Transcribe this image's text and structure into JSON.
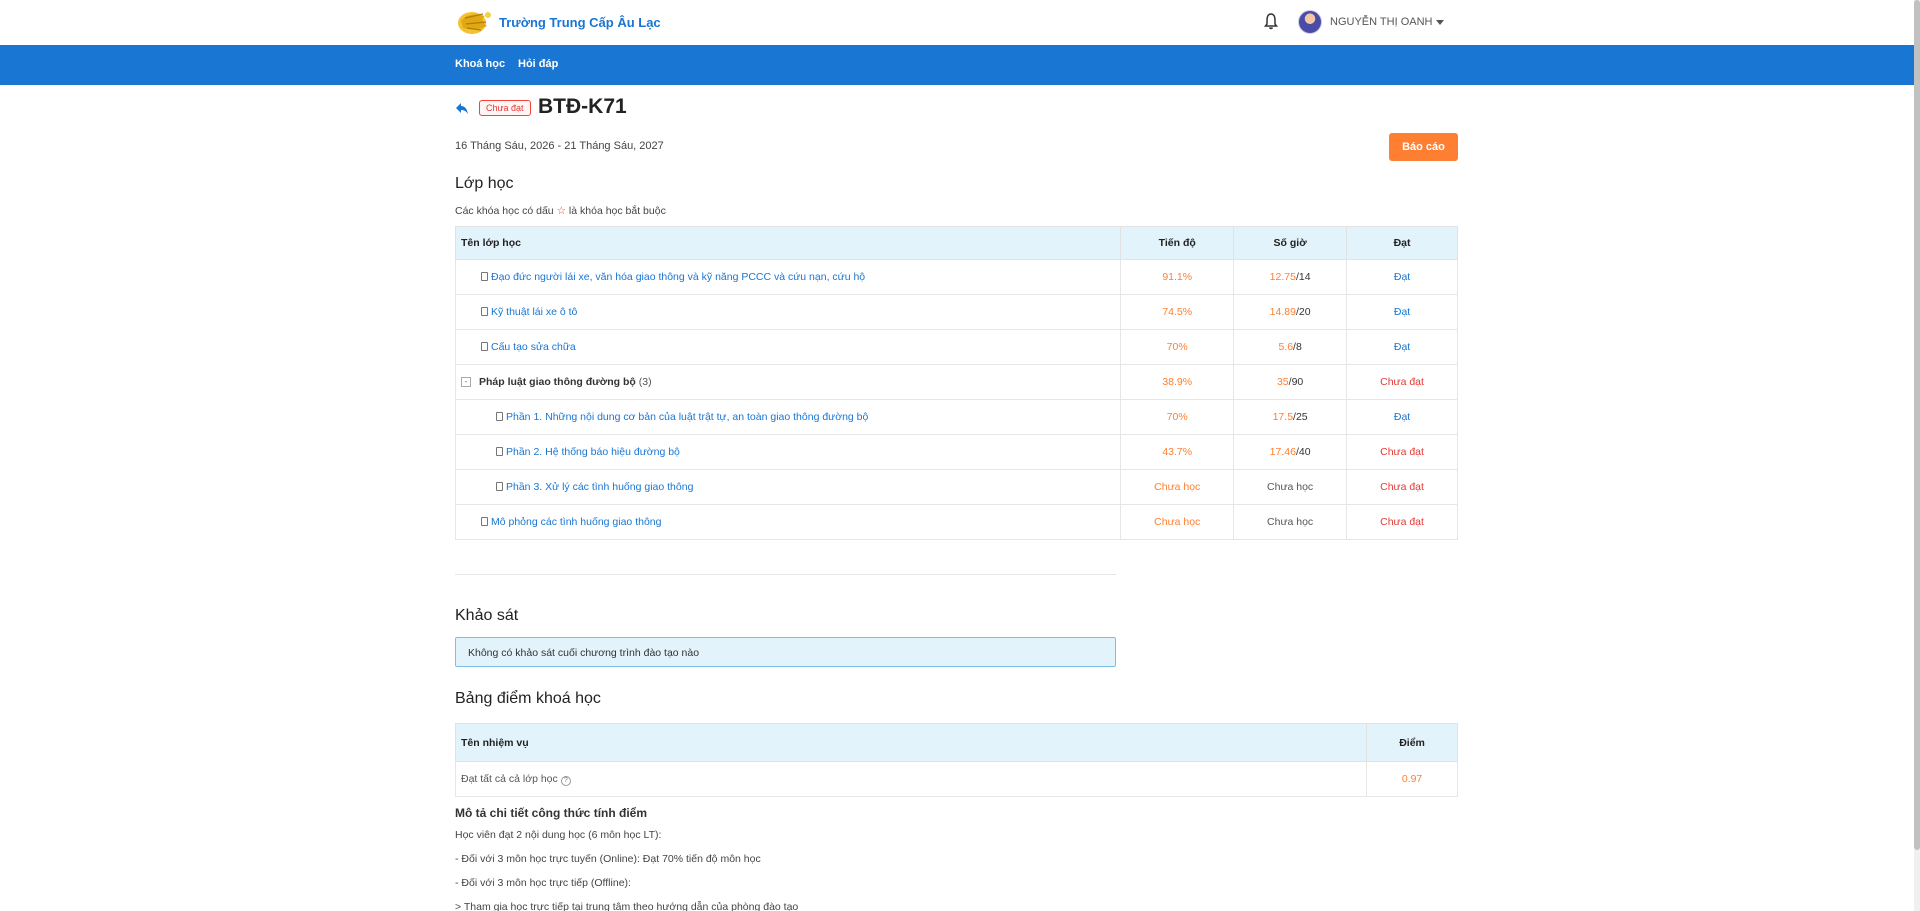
{
  "header": {
    "school_name": "Trường Trung Cấp Âu Lạc",
    "user_name": "NGUYỄN THỊ OANH"
  },
  "nav": {
    "items": [
      "Khoá học",
      "Hỏi đáp"
    ]
  },
  "course": {
    "status": "Chưa đạt",
    "title": "BTĐ-K71",
    "date_range": "16 Tháng Sáu, 2026 - 21 Tháng Sáu, 2027",
    "report_button": "Báo cáo"
  },
  "classes": {
    "heading": "Lớp học",
    "note_before": "Các khóa học có dấu",
    "note_star": "☆",
    "note_after": "là khóa học bắt buộc",
    "columns": [
      "Tên lớp học",
      "Tiến độ",
      "Số giờ",
      "Đạt"
    ],
    "rows": [
      {
        "name": "Đạo đức người lái xe, văn hóa giao thông và kỹ năng PCCC và cứu nạn, cứu hộ",
        "progress": "91.1%",
        "hours_done": "12.75",
        "hours_total": "/14",
        "result": "Đạt"
      },
      {
        "name": "Kỹ thuật lái xe ô tô",
        "progress": "74.5%",
        "hours_done": "14.89",
        "hours_total": "/20",
        "result": "Đạt"
      },
      {
        "name": "Cấu tạo sửa chữa",
        "progress": "70%",
        "hours_done": "5.6",
        "hours_total": "/8",
        "result": "Đạt"
      },
      {
        "name": "Pháp luật giao thông đường bộ",
        "count": "(3)",
        "progress": "38.9%",
        "hours_done": "35",
        "hours_total": "/90",
        "result": "Chưa đạt"
      },
      {
        "name": "Phần 1. Những nội dung cơ bản của luật trật tự, an toàn giao thông đường bộ",
        "progress": "70%",
        "hours_done": "17.5",
        "hours_total": "/25",
        "result": "Đạt"
      },
      {
        "name": "Phần 2. Hệ thống báo hiệu đường bộ",
        "progress": "43.7%",
        "hours_done": "17.46",
        "hours_total": "/40",
        "result": "Chưa đạt"
      },
      {
        "name": "Phần 3. Xử lý các tình huống giao thông",
        "progress": "Chưa học",
        "hours": "Chưa học",
        "result": "Chưa đạt"
      },
      {
        "name": "Mô phỏng các tình huống giao thông",
        "progress": "Chưa học",
        "hours": "Chưa học",
        "result": "Chưa đạt"
      }
    ]
  },
  "survey": {
    "heading": "Khảo sát",
    "message": "Không có khảo sát cuối chương trình đào tạo nào"
  },
  "scores": {
    "heading": "Bảng điểm khoá học",
    "columns": [
      "Tên nhiệm vụ",
      "Điểm"
    ],
    "rows": [
      {
        "task": "Đạt tất cả cả lớp học",
        "score": "0.97"
      }
    ]
  },
  "formula": {
    "heading": "Mô tả chi tiết công thức tính điểm",
    "lines": [
      "Học viên đạt 2 nội dung học (6 môn học LT):",
      "- Đối với 3 môn học trực tuyến (Online): Đạt 70% tiến độ môn học",
      "- Đối với 3 môn học trực tiếp (Offline):",
      "> Tham gia học trực tiếp tại trung tâm theo hướng dẫn của phòng đào tạo"
    ]
  },
  "colors": {
    "primary": "#1976d2",
    "accent": "#ff7f32",
    "danger": "#e53935",
    "table_header": "#e3f3fc"
  }
}
